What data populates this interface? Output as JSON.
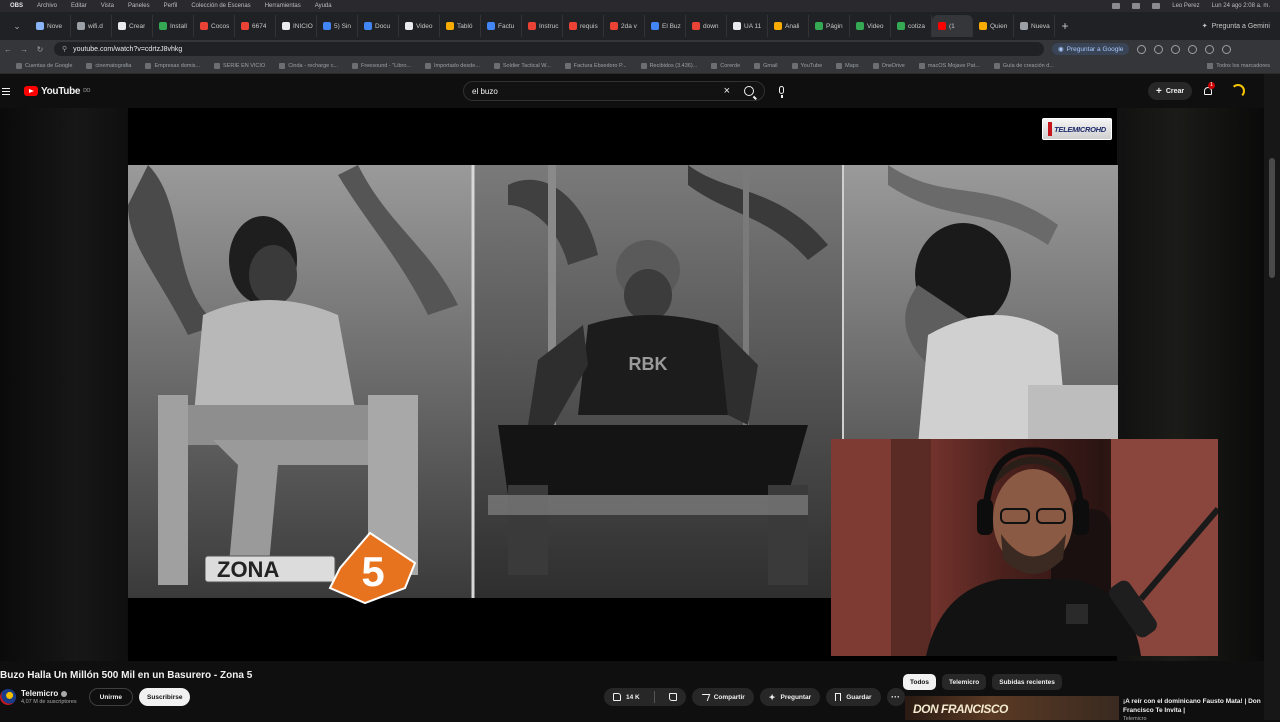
{
  "os_menu": {
    "app": "OBS",
    "items": [
      "Archivo",
      "Editar",
      "Vista",
      "Paneles",
      "Perfil",
      "Colección de Escenas",
      "Herramientas",
      "Ayuda"
    ],
    "user": "Leo Perez",
    "clock": "Lun 24 ago 2:08 a. m."
  },
  "tabs": [
    {
      "label": "Nove",
      "color": "#8ab4f8"
    },
    {
      "label": "wifi.d",
      "color": "#9aa0a6"
    },
    {
      "label": "Crear",
      "color": "#e8eaed"
    },
    {
      "label": "Install",
      "color": "#34a853"
    },
    {
      "label": "Cocos",
      "color": "#ea4335"
    },
    {
      "label": "6674",
      "color": "#ea4335"
    },
    {
      "label": "INICIO",
      "color": "#e8eaed"
    },
    {
      "label": "5) Sin",
      "color": "#4285f4"
    },
    {
      "label": "Docu",
      "color": "#4285f4"
    },
    {
      "label": "Video",
      "color": "#e8eaed"
    },
    {
      "label": "Tabló",
      "color": "#f9ab00"
    },
    {
      "label": "Factu",
      "color": "#4285f4"
    },
    {
      "label": "Instruc",
      "color": "#ea4335"
    },
    {
      "label": "requis",
      "color": "#ea4335"
    },
    {
      "label": "2da v",
      "color": "#ea4335"
    },
    {
      "label": "El Buz",
      "color": "#4285f4"
    },
    {
      "label": "down",
      "color": "#ea4335"
    },
    {
      "label": "UA 11",
      "color": "#e8eaed"
    },
    {
      "label": "Anali",
      "color": "#f9ab00"
    },
    {
      "label": "Págin",
      "color": "#34a853"
    },
    {
      "label": "Video",
      "color": "#34a853"
    },
    {
      "label": "cotiza",
      "color": "#34a853"
    },
    {
      "label": "(1",
      "color": "#ff0000",
      "active": true
    },
    {
      "label": "Quien",
      "color": "#f9ab00"
    },
    {
      "label": "Nueva",
      "color": "#9aa0a6"
    }
  ],
  "new_tab": "+",
  "gemini_tab": "Pregunta a Gemini",
  "address": {
    "url": "youtube.com/watch?v=cdrtzJ8vhkg",
    "ask_google": "Preguntar a Google"
  },
  "bookmarks": [
    "Cuentas de Google",
    "cinematografia",
    "Empresas domis...",
    "SERIE EN VICIO",
    "Cinda - recharge c...",
    "Freesound - \"Libro...",
    "Importado desde...",
    "Soldier Tactical W...",
    "Factura Ebsedoro P...",
    "Recibidos (3.436)...",
    "Corerde",
    "Gmail",
    "YouTube",
    "Maps",
    "OneDrive",
    "macOS Mojave Pat...",
    "Guía de creación d..."
  ],
  "all_bookmarks": "Todos los marcadores",
  "youtube": {
    "logo_text": "YouTube",
    "logo_region": "DO",
    "search_value": "el buzo",
    "create_label": "Crear",
    "notif_count": "1"
  },
  "video": {
    "channel_bug": "TELEMICROHD",
    "overlay_text": "ZONA",
    "overlay_number": "5",
    "title": "Buzo Halla Un Millón 500 Mil en un Basurero - Zona 5",
    "channel": "Telemicro",
    "subscribers": "4,07 M de suscriptores",
    "join_label": "Unirme",
    "subscribe_label": "Suscribirse",
    "likes": "14 K",
    "share_label": "Compartir",
    "ask_label": "Preguntar",
    "save_label": "Guardar",
    "more_label": "···"
  },
  "chips": [
    "Todos",
    "Telemicro",
    "Subidas recientes"
  ],
  "recommendation": {
    "thumb_text": "DON FRANCISCO",
    "title": "¡A reír con el dominicano Fausto Mata! | Don Francisco Te Invita |",
    "channel": "Telemicro"
  }
}
